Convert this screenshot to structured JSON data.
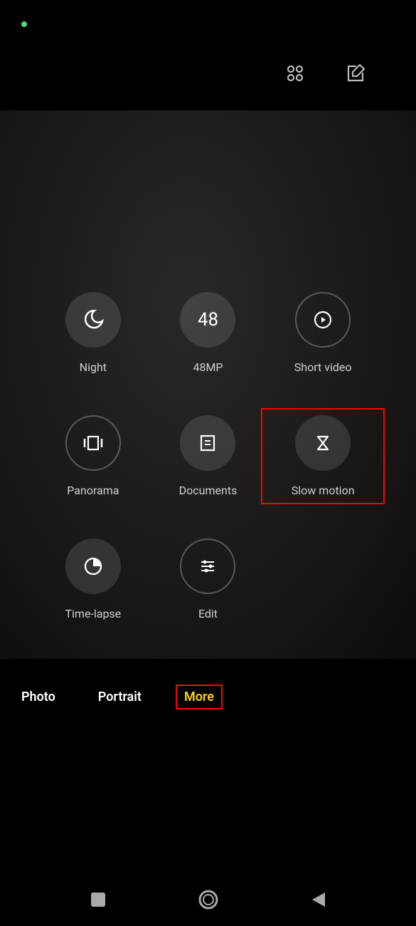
{
  "statusBar": {
    "indicatorActive": true
  },
  "topToolbar": {
    "gridIcon": "grid-icon",
    "editIcon": "edit-icon"
  },
  "modes": [
    {
      "id": "night",
      "label": "Night",
      "style": "filled",
      "icon": "moon"
    },
    {
      "id": "48mp",
      "label": "48MP",
      "style": "filled",
      "icon": "text",
      "text": "48"
    },
    {
      "id": "short-video",
      "label": "Short video",
      "style": "outlined",
      "icon": "play-circle"
    },
    {
      "id": "panorama",
      "label": "Panorama",
      "style": "outlined",
      "icon": "pano"
    },
    {
      "id": "documents",
      "label": "Documents",
      "style": "filled",
      "icon": "document"
    },
    {
      "id": "slow-motion",
      "label": "Slow motion",
      "style": "filled",
      "icon": "hourglass",
      "highlighted": true
    },
    {
      "id": "time-lapse",
      "label": "Time-lapse",
      "style": "filled",
      "icon": "clock-pie"
    },
    {
      "id": "edit",
      "label": "Edit",
      "style": "outlined",
      "icon": "sliders"
    }
  ],
  "tabs": [
    {
      "id": "photo",
      "label": "Photo",
      "active": false
    },
    {
      "id": "portrait",
      "label": "Portrait",
      "active": false
    },
    {
      "id": "more",
      "label": "More",
      "active": true
    }
  ],
  "navBar": {
    "recent": "recent-apps",
    "home": "home",
    "back": "back"
  }
}
